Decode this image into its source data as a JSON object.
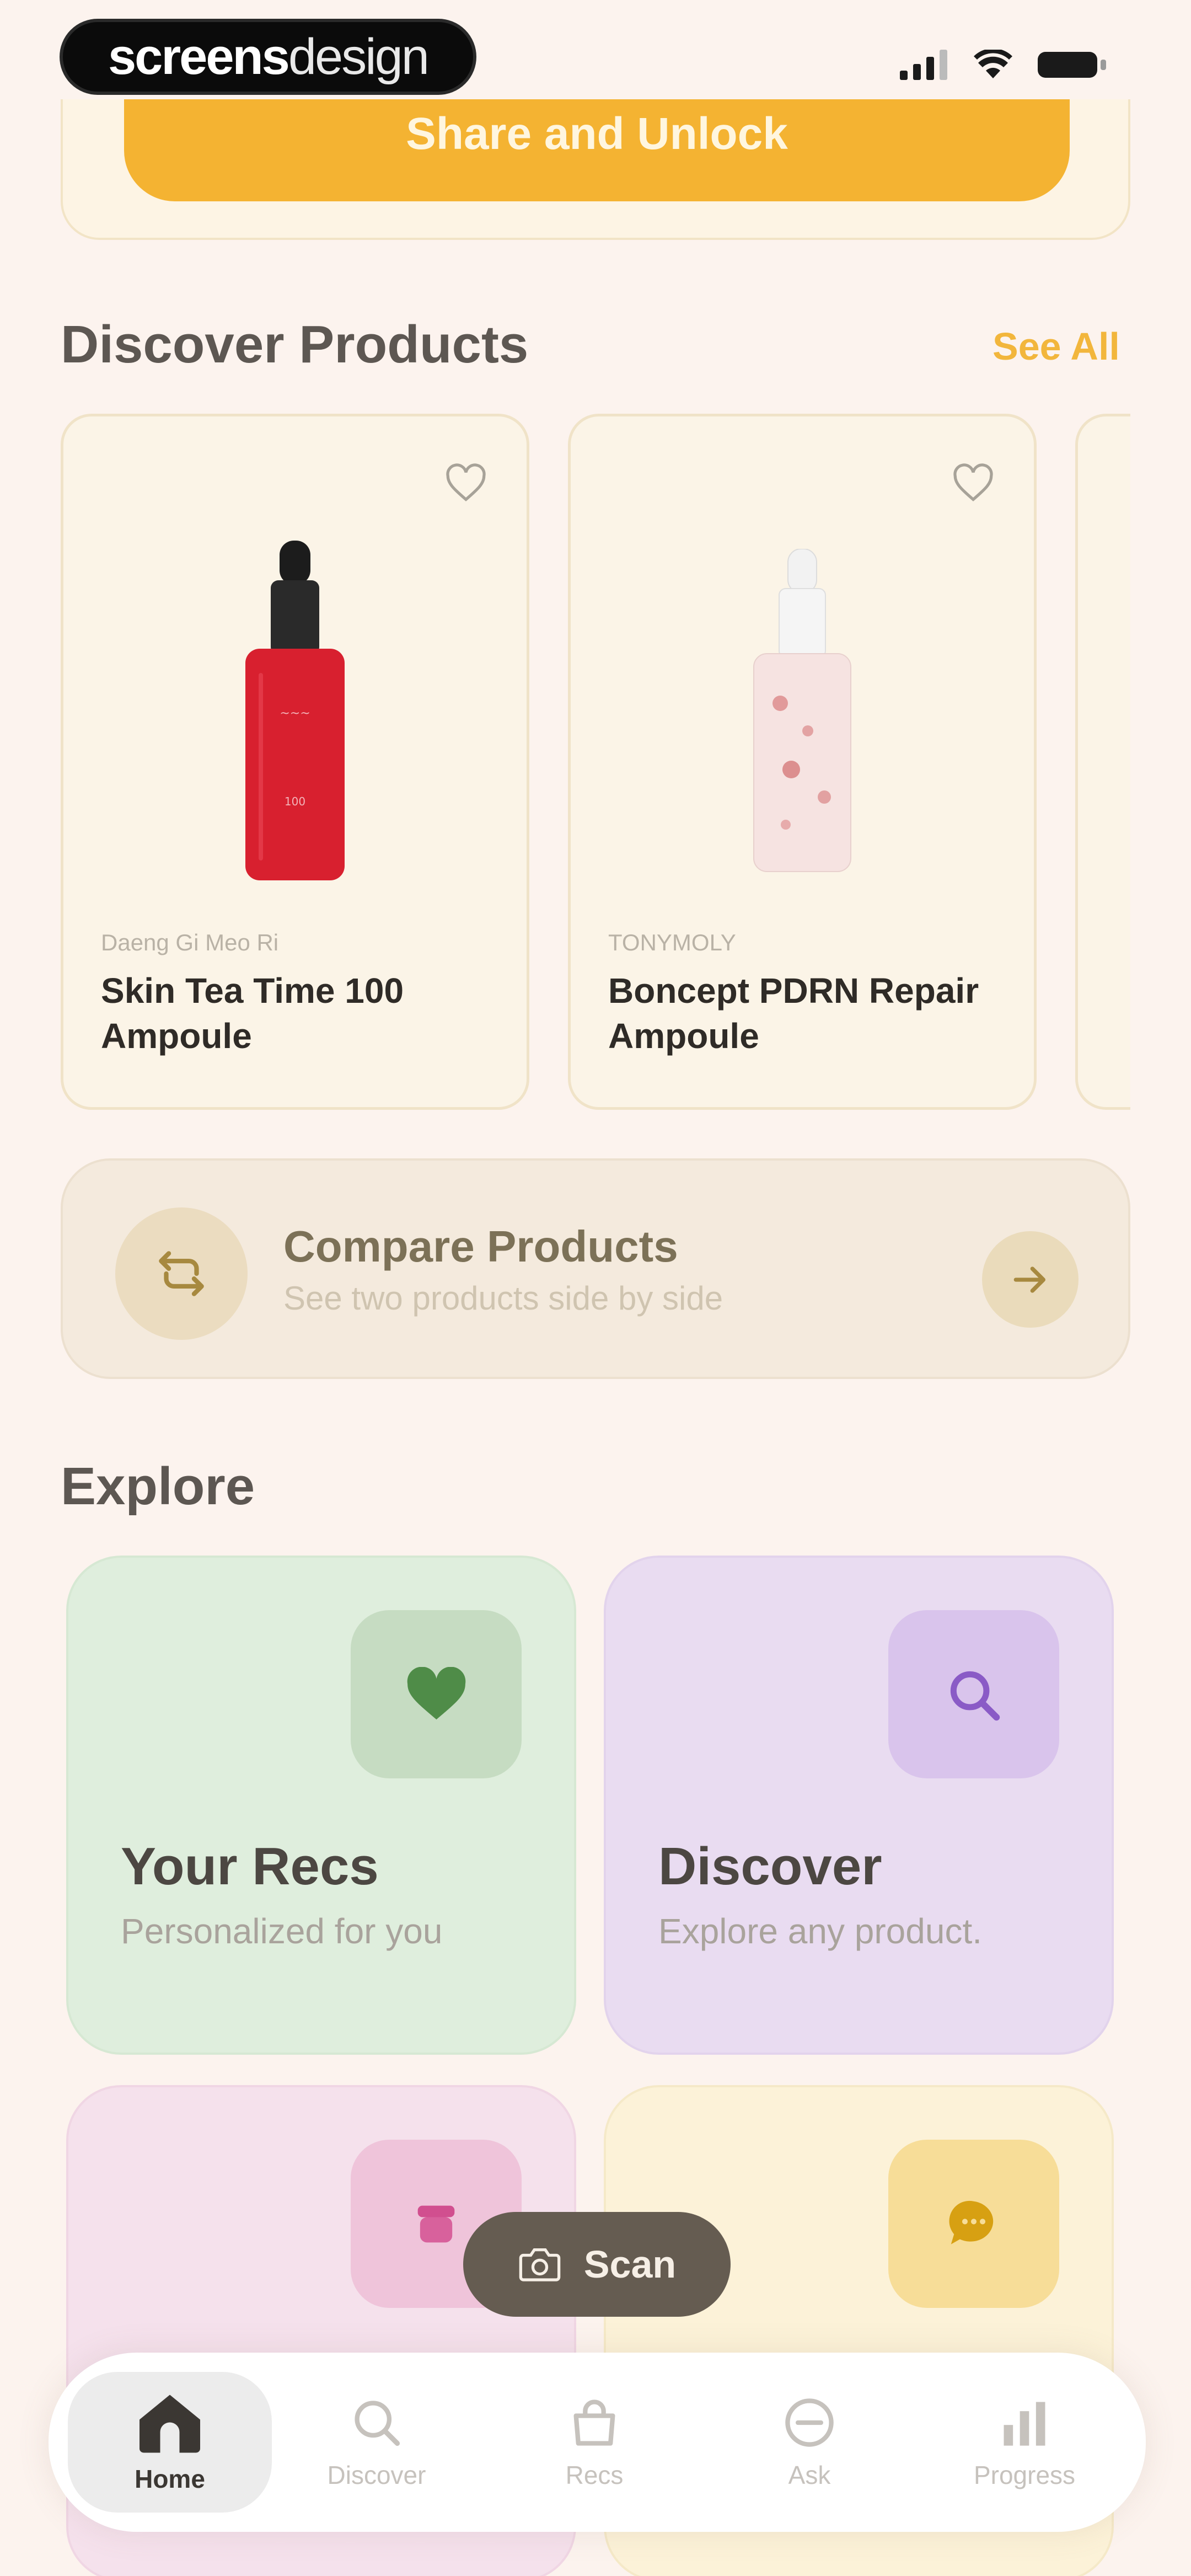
{
  "status_bar": {
    "logo_bold": "screens",
    "logo_light": "design"
  },
  "share": {
    "button_label": "Share and Unlock"
  },
  "discover_products": {
    "title": "Discover Products",
    "see_all": "See All",
    "products": [
      {
        "brand": "Daeng Gi Meo Ri",
        "name": "Skin Tea Time 100 Ampoule",
        "bottle_color": "#d8202f"
      },
      {
        "brand": "TONYMOLY",
        "name": "Boncept PDRN Repair Ampoule",
        "bottle_color": "#f3d9d9"
      }
    ]
  },
  "compare": {
    "title": "Compare Products",
    "subtitle": "See two products side by side"
  },
  "explore": {
    "title": "Explore",
    "tiles": [
      {
        "title": "Your Recs",
        "subtitle": "Personalized for you",
        "icon": "heart-icon",
        "bg": "#dfeedd"
      },
      {
        "title": "Discover",
        "subtitle": "Explore any product.",
        "icon": "search-icon",
        "bg": "#e9dcf1"
      },
      {
        "title": "",
        "subtitle": "",
        "icon": "jar-icon",
        "bg": "#f5e1ec"
      },
      {
        "title": "",
        "subtitle": "",
        "icon": "chat-icon",
        "bg": "#fcf2d8"
      }
    ]
  },
  "scan": {
    "label": "Scan"
  },
  "tabbar": {
    "items": [
      {
        "label": "Home",
        "icon": "home-icon"
      },
      {
        "label": "Discover",
        "icon": "search-icon"
      },
      {
        "label": "Recs",
        "icon": "bag-icon"
      },
      {
        "label": "Ask",
        "icon": "chat-icon"
      },
      {
        "label": "Progress",
        "icon": "chart-icon"
      }
    ]
  }
}
